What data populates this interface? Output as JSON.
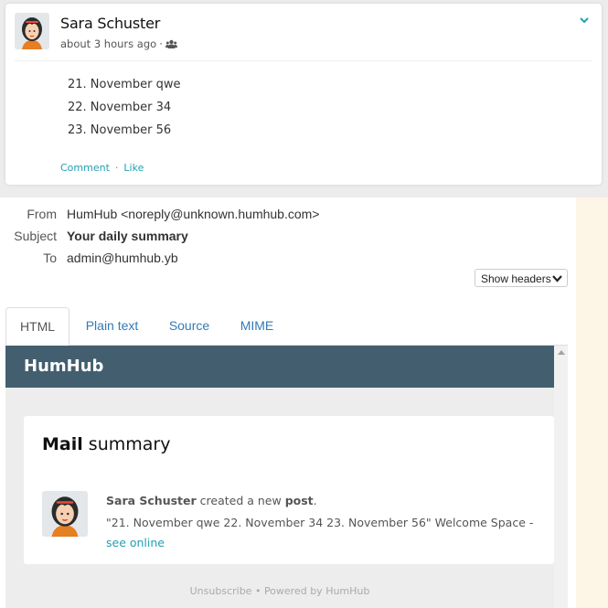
{
  "post": {
    "author": "Sara Schuster",
    "time": "about 3 hours ago",
    "time_separator": "·",
    "visibility_icon": "users-icon",
    "items": [
      "21. November qwe",
      "22. November 34",
      "23. November 56"
    ],
    "actions": {
      "comment": "Comment",
      "separator": "·",
      "like": "Like"
    }
  },
  "mail": {
    "from_label": "From",
    "from_value": "HumHub <noreply@unknown.humhub.com>",
    "subject_label": "Subject",
    "subject_value": "Your daily summary",
    "to_label": "To",
    "to_value": "admin@humhub.yb",
    "show_headers": "Show headers",
    "tabs": [
      "HTML",
      "Plain text",
      "Source",
      "MIME"
    ],
    "active_tab": "HTML"
  },
  "preview": {
    "brand": "HumHub",
    "title_bold": "Mail",
    "title_rest": " summary",
    "activity": {
      "user": "Sara Schuster",
      "verb": " created a new ",
      "object": "post",
      "period": ".",
      "quote": "\"21. November qwe 22. November 34 23. November 56\" Welcome Space - ",
      "link": "see online"
    },
    "footer_unsubscribe": "Unsubscribe",
    "footer_sep": " • ",
    "footer_powered": "Powered by HumHub"
  },
  "colors": {
    "accent": "#21a1b3",
    "brand_bar": "#435f6f",
    "link_blue": "#337ab7"
  }
}
